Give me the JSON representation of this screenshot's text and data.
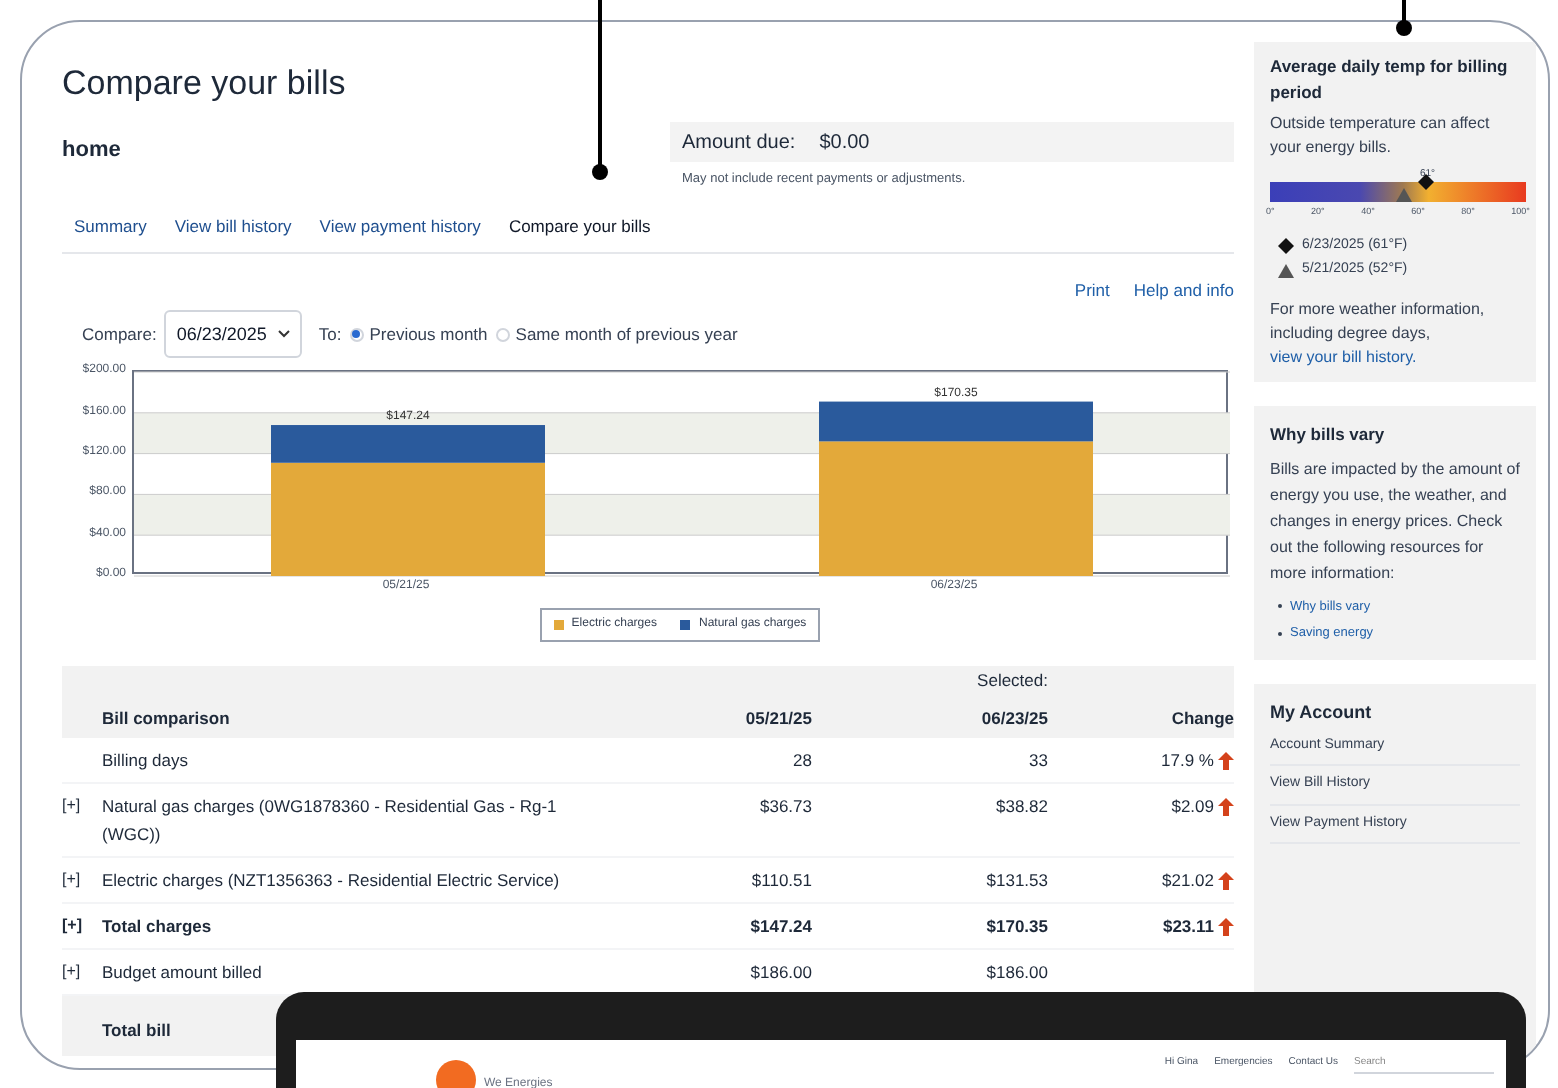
{
  "page": {
    "title": "Compare your bills",
    "account": "home",
    "amount_label": "Amount due:",
    "amount_value": "$0.00",
    "amount_note": "May not include recent payments or adjustments."
  },
  "tabs": [
    {
      "label": "Summary",
      "selected": false
    },
    {
      "label": "View bill history",
      "selected": false
    },
    {
      "label": "View payment history",
      "selected": false
    },
    {
      "label": "Compare your bills",
      "selected": true
    }
  ],
  "links": [
    "Print",
    "Help and info"
  ],
  "compare": {
    "label": "Compare:",
    "date": "06/23/2025",
    "to_label": "To:",
    "options": [
      {
        "label": "Previous month",
        "selected": true
      },
      {
        "label": "Same month of previous year",
        "selected": false
      }
    ]
  },
  "chart_data": {
    "type": "bar",
    "stacked": true,
    "categories": [
      "05/21/25",
      "06/23/25"
    ],
    "series": [
      {
        "name": "Electric charges",
        "color": "#e3a93a",
        "values": [
          111,
          132
        ]
      },
      {
        "name": "Natural gas charges",
        "color": "#2a5a9c",
        "values": [
          37,
          39
        ]
      }
    ],
    "grid": true,
    "legend": true,
    "ylim": [
      0,
      200
    ],
    "yticks": [
      {
        "value": 0,
        "label": "$0.00"
      },
      {
        "value": 40,
        "label": "$40.00"
      },
      {
        "value": 80,
        "label": "$80.00"
      },
      {
        "value": 120,
        "label": "$120.00"
      },
      {
        "value": 160,
        "label": "$160.00"
      },
      {
        "value": 200,
        "label": "$200.00"
      }
    ],
    "value_labels": [
      "$147.24",
      "$170.35"
    ]
  },
  "table": {
    "columns": [
      "Bill comparison",
      "05/21/25",
      "Selected:",
      "06/23/25",
      "Change"
    ],
    "rows": [
      {
        "toggle": "",
        "label": "Billing days",
        "col_1": "28",
        "col_2": "33",
        "change": "17.9 %",
        "increase": true,
        "bold": false
      },
      {
        "toggle": "[+]",
        "label": "Natural gas charges (0WG1878360 - Residential Gas - Rg-1 (WGC))",
        "col_1": "$36.73",
        "col_2": "$38.82",
        "change": "$2.09",
        "increase": true,
        "bold": false
      },
      {
        "toggle": "[+]",
        "label": "Electric charges (NZT1356363 - Residential Electric Service)",
        "col_1": "$110.51",
        "col_2": "$131.53",
        "change": "$21.02",
        "increase": true,
        "bold": false
      },
      {
        "toggle": "[+]",
        "label": "Total charges",
        "col_1": "$147.24",
        "col_2": "$170.35",
        "change": "$23.11",
        "increase": true,
        "bold": true
      },
      {
        "toggle": "[+]",
        "label": "Budget amount billed",
        "col_1": "$186.00",
        "col_2": "$186.00",
        "change": "",
        "increase": false,
        "bold": false
      }
    ],
    "footer": "Total bill"
  },
  "sidebar": {
    "temp": {
      "title": "Average daily temp for billing period",
      "text": "Outside temperature can affect your energy bills.",
      "scale": [
        "0°",
        "20°",
        "40°",
        "60°",
        "80°",
        "100°"
      ],
      "marker_label": "61°",
      "markers": [
        {
          "kind": "diamond",
          "level": 0.61,
          "label": "6/23/2025 (61°F)"
        },
        {
          "kind": "triangle",
          "level": 0.52,
          "label": "5/21/2025 (52°F)"
        }
      ],
      "more_text": "For more weather information, including degree days,",
      "more_link": "view your bill history."
    },
    "vary": {
      "title": "Why bills vary",
      "text": "Bills are impacted by the amount of energy you use, the weather, and changes in energy prices. Check out the following resources for more information:",
      "links": [
        "Why bills vary",
        "Saving energy"
      ]
    },
    "account": {
      "title": "My Account",
      "links": [
        "Account Summary",
        "View Bill History",
        "View Payment History"
      ]
    }
  },
  "laptop": {
    "brand": "We Energies",
    "nav": [
      "Hi Gina",
      "Emergencies",
      "Contact Us"
    ],
    "search_placeholder": "Search"
  }
}
